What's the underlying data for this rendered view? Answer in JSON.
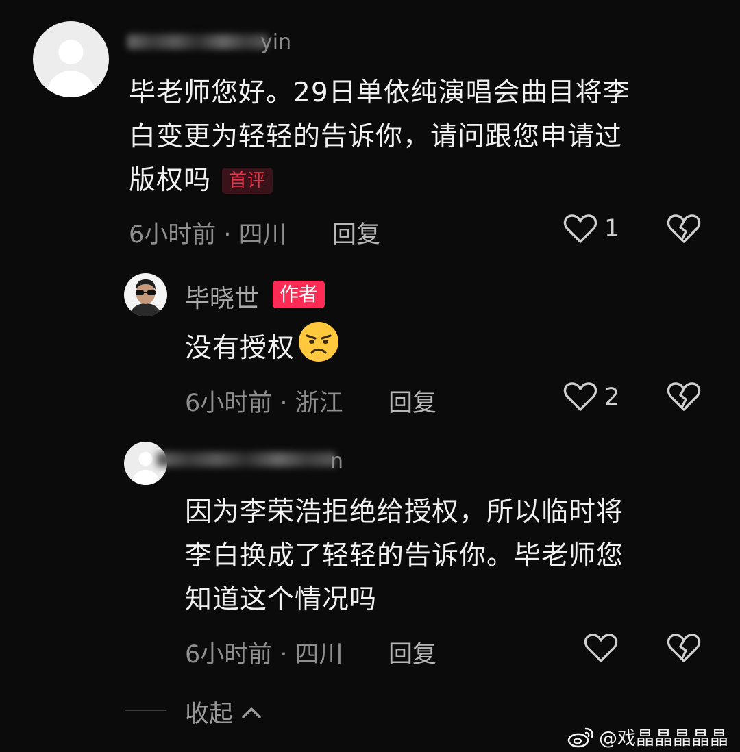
{
  "comments": [
    {
      "username_visible": "yin",
      "text_lines": [
        "毕老师您好。29日单依纯演唱会曲目将李",
        "白变更为轻轻的告诉你，请问跟您申请过",
        "版权吗"
      ],
      "tag": "首评",
      "meta": "6小时前 · 四川",
      "reply_label": "回复",
      "like_count": "1"
    },
    {
      "username": "毕晓世",
      "tag": "作者",
      "text": "没有授权",
      "emoji": "😒",
      "meta": "6小时前 · 浙江",
      "reply_label": "回复",
      "like_count": "2"
    },
    {
      "username_visible": "n",
      "text_lines": [
        "因为李荣浩拒绝给授权，所以临时将",
        "李白换成了轻轻的告诉你。毕老师您",
        "知道这个情况吗"
      ],
      "meta": "6小时前 · 四川",
      "reply_label": "回复"
    }
  ],
  "collapse_label": "收起",
  "watermark": "@戏晶晶晶晶晶",
  "icons": {
    "avatar_placeholder": "default-avatar-icon",
    "like": "heart-outline-icon",
    "dislike": "broken-heart-icon",
    "collapse": "chevron-up-icon",
    "weibo": "weibo-logo-icon"
  },
  "colors": {
    "background": "#0b0b0b",
    "author_tag": "#fe2c55",
    "first_comment_tag_text": "#e5374c"
  }
}
